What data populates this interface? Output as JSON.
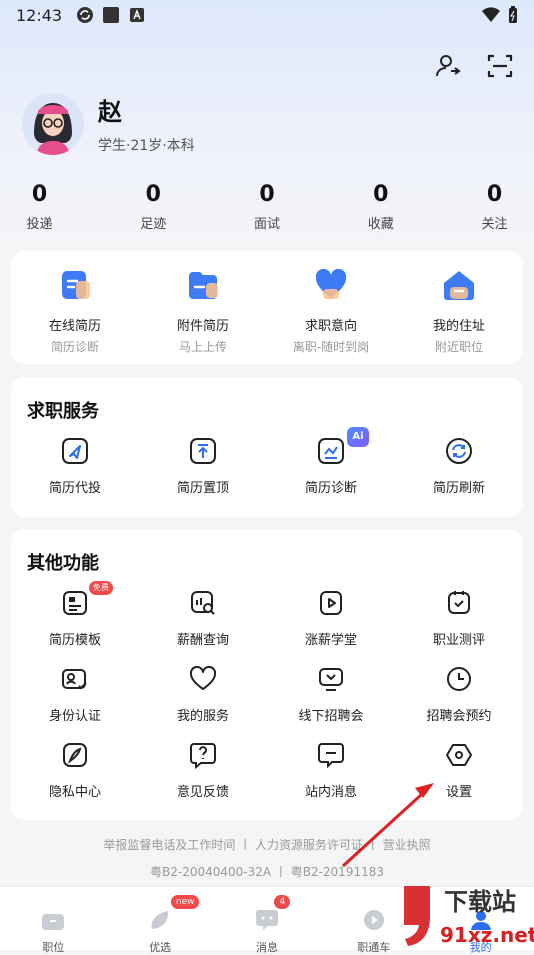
{
  "status": {
    "time": "12:43"
  },
  "profile": {
    "name": "赵",
    "desc": "学生·21岁·本科"
  },
  "stats": [
    {
      "v": "0",
      "l": "投递"
    },
    {
      "v": "0",
      "l": "足迹"
    },
    {
      "v": "0",
      "l": "面试"
    },
    {
      "v": "0",
      "l": "收藏"
    },
    {
      "v": "0",
      "l": "关注"
    }
  ],
  "quick": [
    {
      "t": "在线简历",
      "s": "简历诊断"
    },
    {
      "t": "附件简历",
      "s": "马上上传"
    },
    {
      "t": "求职意向",
      "s": "离职-随时到岗"
    },
    {
      "t": "我的住址",
      "s": "附近职位"
    }
  ],
  "services": {
    "title": "求职服务",
    "badge": "Ai",
    "items": [
      "简历代投",
      "简历置顶",
      "简历诊断",
      "简历刷新"
    ]
  },
  "other": {
    "title": "其他功能",
    "free_badge": "免费",
    "items": [
      "简历模板",
      "薪酬查询",
      "涨薪学堂",
      "职业测评",
      "身份认证",
      "我的服务",
      "线下招聘会",
      "招聘会预约",
      "隐私中心",
      "意见反馈",
      "站内消息",
      "设置"
    ]
  },
  "footer": {
    "line1": "举报监督电话及工作时间 丨 人力资源服务许可证 丨 营业执照",
    "line2": "粤B2-20040400-32A 丨 粤B2-20191183"
  },
  "tabs": [
    {
      "t": "职位"
    },
    {
      "t": "优选",
      "badge": "new"
    },
    {
      "t": "消息",
      "badge": "4"
    },
    {
      "t": "职通车"
    },
    {
      "t": "我的"
    }
  ],
  "watermark": {
    "top": "下载站",
    "bottom": "91xz.net"
  },
  "colors": {
    "accent": "#2b6ff0",
    "badge": "#f04a4a",
    "arrow": "#e02020"
  }
}
